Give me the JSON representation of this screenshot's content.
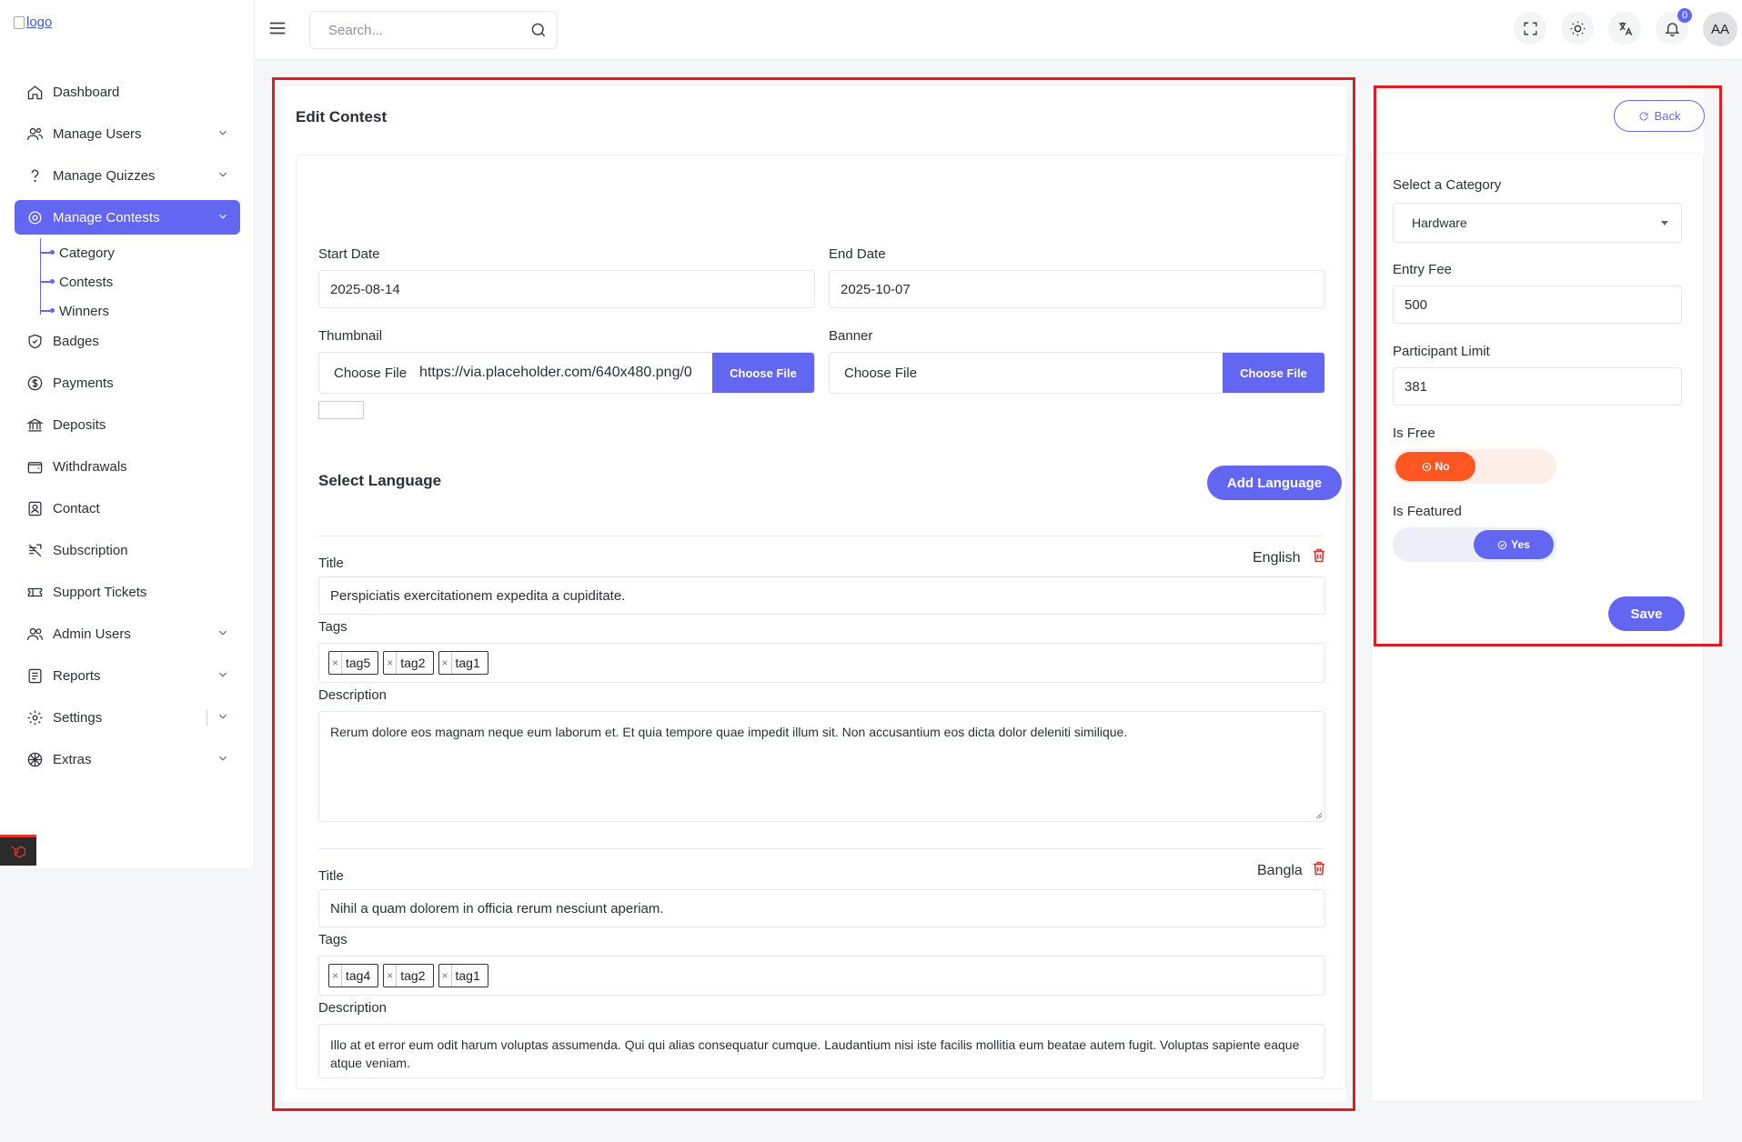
{
  "brand": {
    "logo_alt": "logo"
  },
  "search": {
    "placeholder": "Search..."
  },
  "topbar": {
    "notification_count": "0",
    "avatar_initials": "AA"
  },
  "sidebar": {
    "items": [
      {
        "label": "Dashboard",
        "icon": "home-icon",
        "has_chevron": false
      },
      {
        "label": "Manage Users",
        "icon": "users-icon",
        "has_chevron": true
      },
      {
        "label": "Manage Quizzes",
        "icon": "question-icon",
        "has_chevron": true
      },
      {
        "label": "Manage Contests",
        "icon": "contest-icon",
        "has_chevron": true,
        "active": true
      },
      {
        "label": "Badges",
        "icon": "badge-icon",
        "has_chevron": false
      },
      {
        "label": "Payments",
        "icon": "dollar-icon",
        "has_chevron": false
      },
      {
        "label": "Deposits",
        "icon": "bank-icon",
        "has_chevron": false
      },
      {
        "label": "Withdrawals",
        "icon": "wallet-icon",
        "has_chevron": false
      },
      {
        "label": "Contact",
        "icon": "contact-icon",
        "has_chevron": false
      },
      {
        "label": "Subscription",
        "icon": "subscription-icon",
        "has_chevron": false
      },
      {
        "label": "Support Tickets",
        "icon": "ticket-icon",
        "has_chevron": false
      },
      {
        "label": "Admin Users",
        "icon": "admin-users-icon",
        "has_chevron": true
      },
      {
        "label": "Reports",
        "icon": "report-icon",
        "has_chevron": true
      },
      {
        "label": "Settings",
        "icon": "gear-icon",
        "has_chevron": true
      },
      {
        "label": "Extras",
        "icon": "extras-icon",
        "has_chevron": true
      }
    ],
    "subitems": [
      "Category",
      "Contests",
      "Winners"
    ]
  },
  "form": {
    "title": "Edit Contest",
    "start_date_label": "Start Date",
    "start_date": "2025-08-14",
    "end_date_label": "End Date",
    "end_date": "2025-10-07",
    "thumbnail_label": "Thumbnail",
    "thumbnail_choose": "Choose File",
    "thumbnail_file": "https://via.placeholder.com/640x480.png/0",
    "thumbnail_button": "Choose File",
    "banner_label": "Banner",
    "banner_choose": "Choose File",
    "banner_button": "Choose File",
    "select_language": "Select Language",
    "add_language": "Add Language",
    "languages": [
      {
        "name": "English",
        "title_label": "Title",
        "title": "Perspiciatis exercitationem expedita a cupiditate.",
        "tags_label": "Tags",
        "tags": [
          "tag5",
          "tag2",
          "tag1"
        ],
        "description_label": "Description",
        "description": "Rerum dolore eos magnam neque eum laborum et. Et quia tempore quae impedit illum sit. Non accusantium eos dicta dolor deleniti similique."
      },
      {
        "name": "Bangla",
        "title_label": "Title",
        "title": "Nihil a quam dolorem in officia rerum nesciunt aperiam.",
        "tags_label": "Tags",
        "tags": [
          "tag4",
          "tag2",
          "tag1"
        ],
        "description_label": "Description",
        "description": "Illo at et error eum odit harum voluptas assumenda. Qui qui alias consequatur cumque. Laudantium nisi iste facilis mollitia eum beatae autem fugit. Voluptas sapiente eaque atque veniam."
      }
    ]
  },
  "side": {
    "back": "Back",
    "category_label": "Select a Category",
    "category": "Hardware",
    "entry_fee_label": "Entry Fee",
    "entry_fee": "500",
    "participant_limit_label": "Participant Limit",
    "participant_limit": "381",
    "is_free_label": "Is Free",
    "is_free_value": "No",
    "is_featured_label": "Is Featured",
    "is_featured_value": "Yes",
    "save": "Save"
  },
  "colors": {
    "accent": "#6366f1",
    "danger": "#ff5722",
    "highlight": "#e31b23"
  }
}
